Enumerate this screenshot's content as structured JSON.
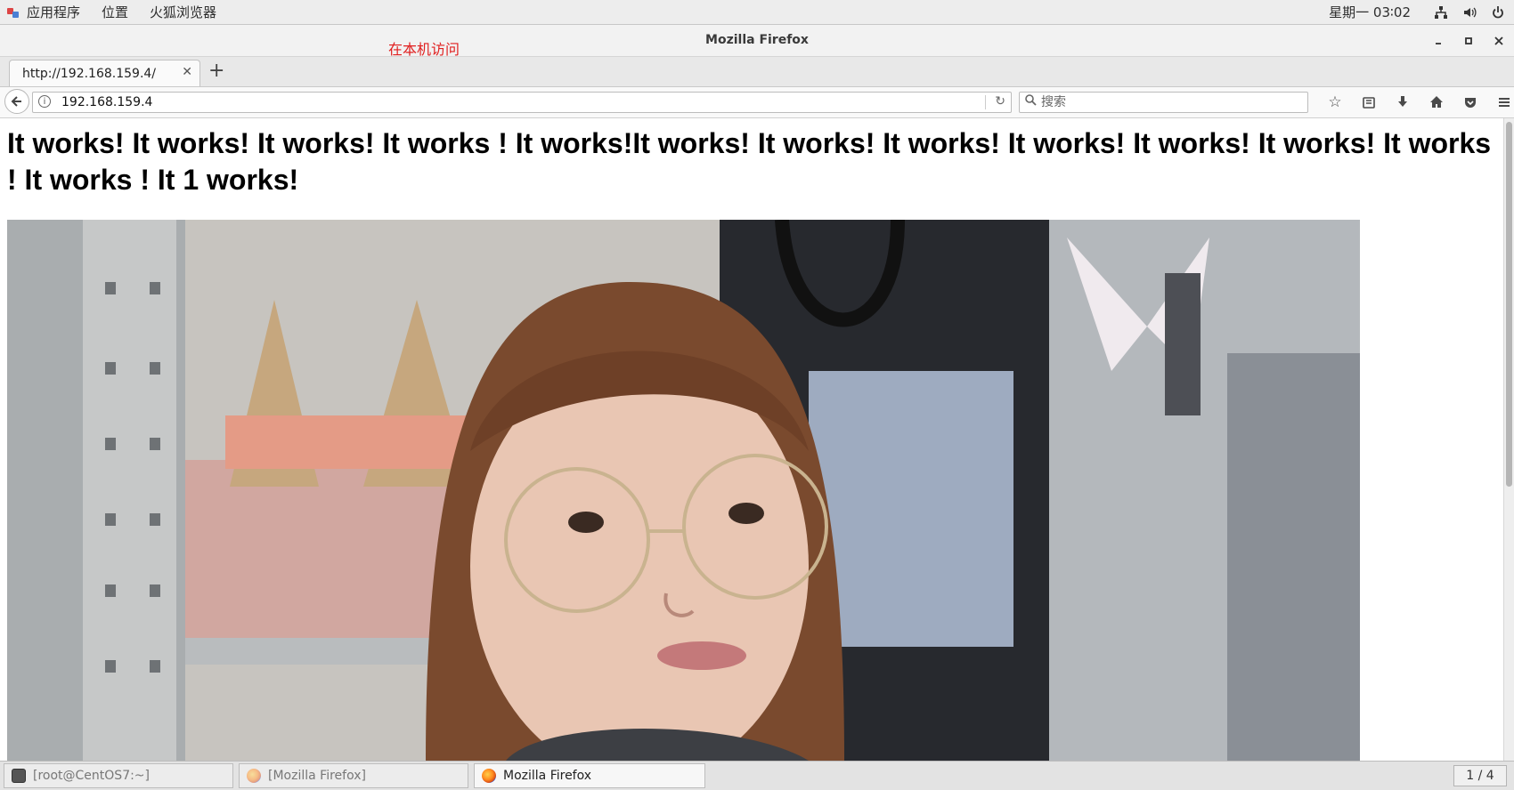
{
  "topbar": {
    "menus": [
      "应用程序",
      "位置",
      "火狐浏览器"
    ],
    "clock": "星期一 03∶02",
    "icons": [
      "network-icon",
      "volume-icon",
      "power-icon"
    ]
  },
  "window": {
    "title": "Mozilla Firefox",
    "annotation": "在本机访问",
    "annotation_color": "#e02020"
  },
  "tabs": [
    {
      "title": "http://192.168.159.4/"
    }
  ],
  "navbar": {
    "url": "192.168.159.4",
    "search_placeholder": "搜索"
  },
  "page": {
    "heading": "It works! It works! It works! It works ! It works!It works! It works! It works! It works! It works! It works! It works ! It works ! It 1 works!"
  },
  "taskbar": {
    "items": [
      {
        "label": "[root@CentOS7:~]",
        "state": "inactive"
      },
      {
        "label": "[Mozilla Firefox]",
        "state": "inactive"
      },
      {
        "label": "Mozilla Firefox",
        "state": "active"
      }
    ],
    "pager": "1 / 4"
  }
}
